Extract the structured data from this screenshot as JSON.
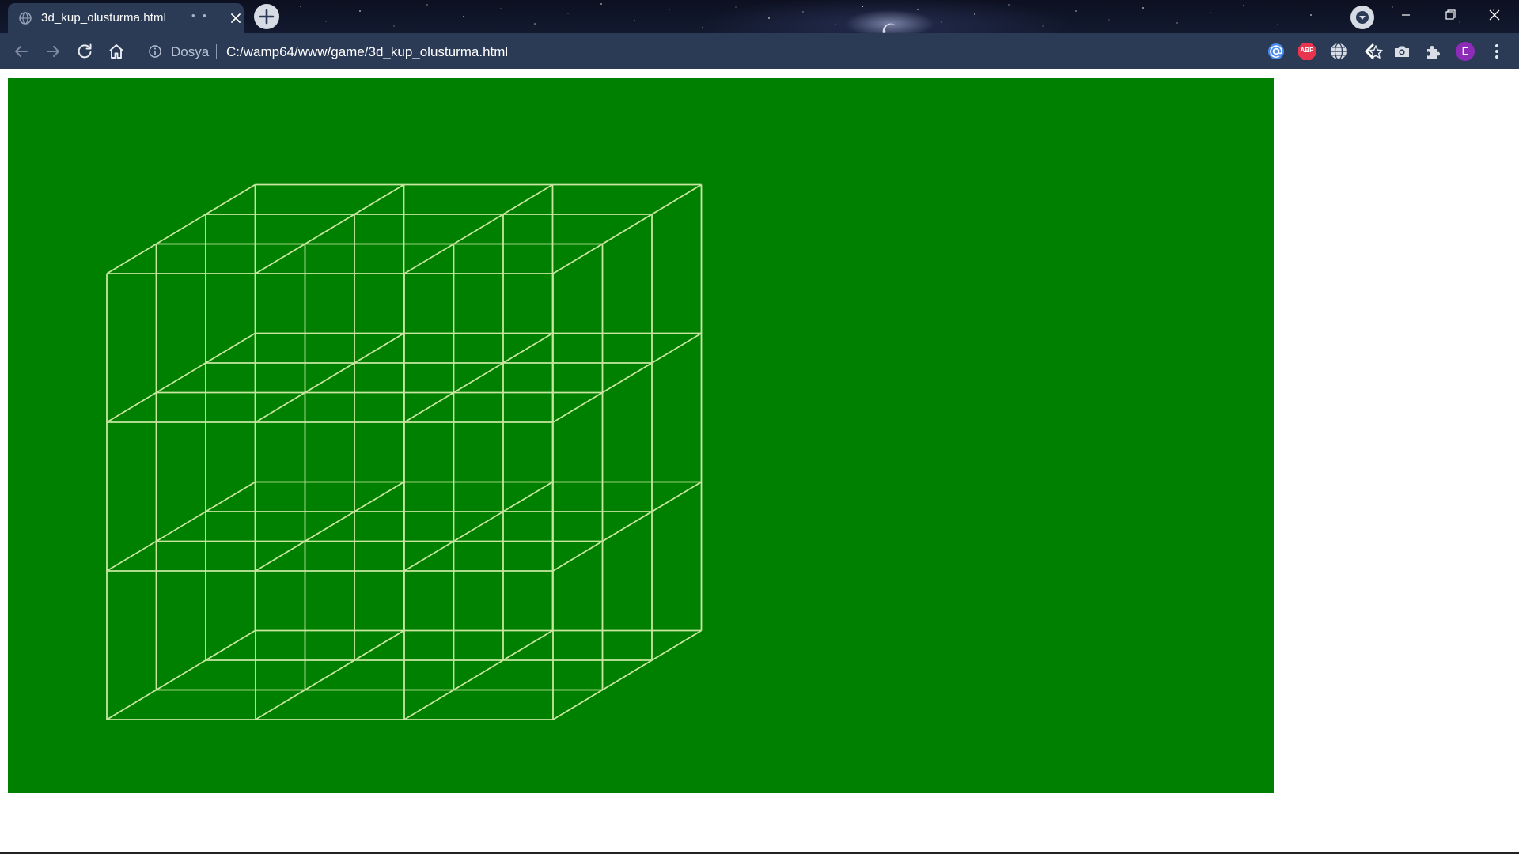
{
  "browser": {
    "tab": {
      "title": "3d_kup_olusturma.html"
    },
    "address": {
      "scheme_label": "Dosya",
      "url": "C:/wamp64/www/game/3d_kup_olusturma.html"
    },
    "extensions": [
      {
        "name": "at-sign-extension",
        "color": "#4a8cf0"
      },
      {
        "name": "adblock-plus",
        "label": "ABP",
        "color": "#e8344e"
      },
      {
        "name": "globe-extension",
        "color": "#d8dde6"
      },
      {
        "name": "back-chevron-extension",
        "color": "#ffffff"
      },
      {
        "name": "camera-extension",
        "color": "#d8dde6"
      },
      {
        "name": "extensions-puzzle",
        "color": "#d8dde6"
      }
    ],
    "profile": {
      "initial": "E",
      "color": "#8e2bb8"
    }
  },
  "canvas": {
    "background": "#008000",
    "line_color": "#c8e6a0",
    "grid": {
      "divisions": 3
    }
  }
}
